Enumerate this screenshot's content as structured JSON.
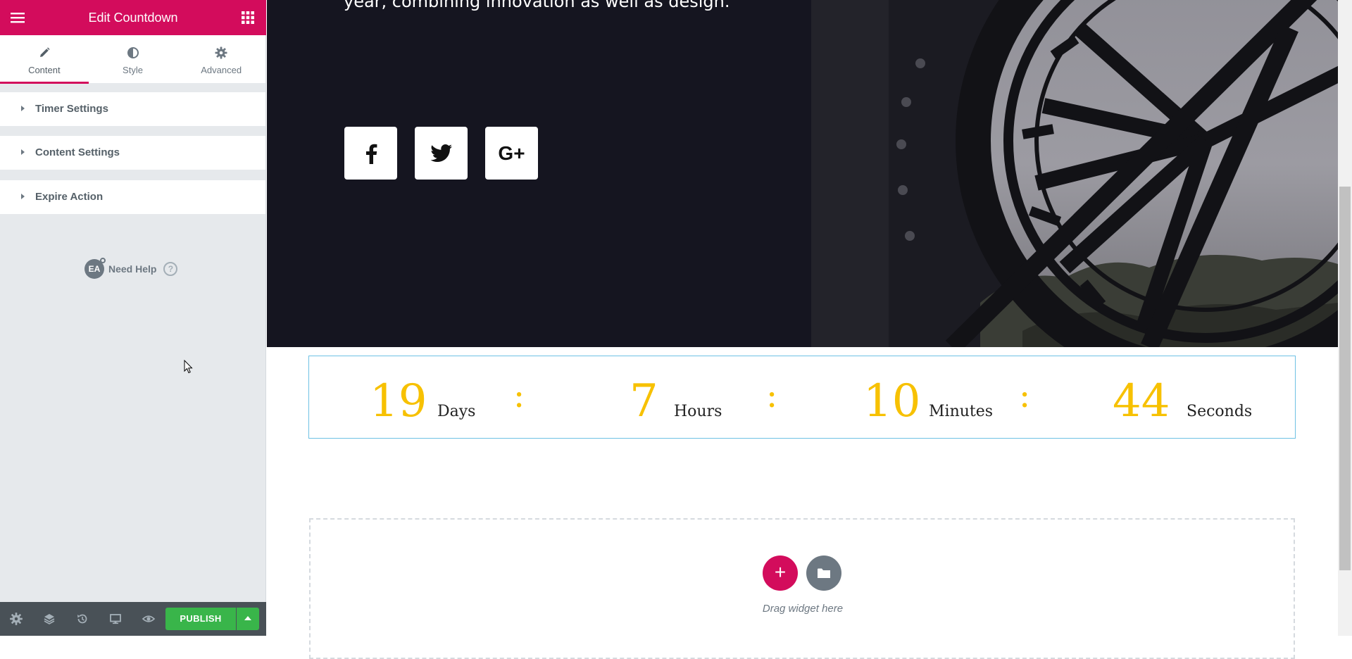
{
  "panel": {
    "title": "Edit Countdown",
    "tabs": [
      {
        "label": "Content",
        "icon": "pencil-icon"
      },
      {
        "label": "Style",
        "icon": "half-circle-icon"
      },
      {
        "label": "Advanced",
        "icon": "gear-icon"
      }
    ],
    "sections": [
      "Timer Settings",
      "Content Settings",
      "Expire Action"
    ],
    "help": {
      "badge": "EA",
      "label": "Need Help",
      "icon_text": "?"
    },
    "footer": {
      "publish_label": "PUBLISH"
    },
    "accent_color": "#d30c5c",
    "publish_color": "#39b54a"
  },
  "hero": {
    "lines": [
      "year, combining innovation as well as design."
    ],
    "social": [
      {
        "name": "facebook",
        "icon": "facebook-icon"
      },
      {
        "name": "twitter",
        "icon": "twitter-icon"
      },
      {
        "name": "google-plus",
        "icon": "google-plus-icon",
        "text": "G+"
      }
    ]
  },
  "countdown": {
    "units": [
      {
        "value": "19",
        "label": "Days"
      },
      {
        "value": "7",
        "label": "Hours"
      },
      {
        "value": "10",
        "label": "Minutes"
      },
      {
        "value": "44",
        "label": "Seconds"
      }
    ],
    "separator": ":",
    "number_color": "#f7c102"
  },
  "dropzone": {
    "add_symbol": "+",
    "text": "Drag widget here"
  }
}
